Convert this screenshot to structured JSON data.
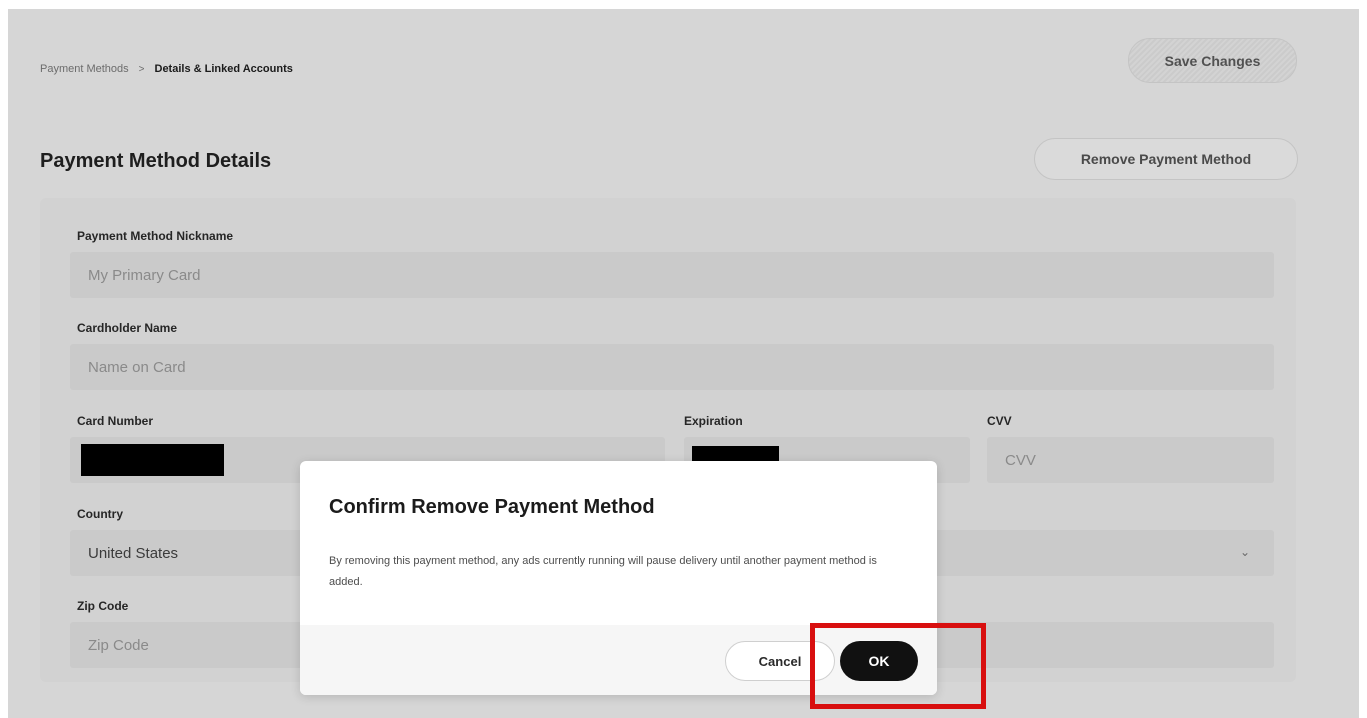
{
  "breadcrumb": {
    "parent": "Payment Methods",
    "separator": ">",
    "current": "Details & Linked Accounts"
  },
  "header": {
    "save_label": "Save Changes",
    "section_title": "Payment Method Details",
    "remove_label": "Remove Payment Method"
  },
  "form": {
    "nickname": {
      "label": "Payment Method Nickname",
      "placeholder": "My Primary Card"
    },
    "cardholder": {
      "label": "Cardholder Name",
      "placeholder": "Name on Card"
    },
    "card_number": {
      "label": "Card Number"
    },
    "expiration": {
      "label": "Expiration"
    },
    "cvv": {
      "label": "CVV",
      "placeholder": "CVV"
    },
    "country": {
      "label": "Country",
      "value": "United States",
      "icon": "chevron-down-icon"
    },
    "zip": {
      "label": "Zip Code",
      "placeholder": "Zip Code"
    }
  },
  "dialog": {
    "title": "Confirm Remove Payment Method",
    "body": "By removing this payment method, any ads currently running will pause delivery until another payment method is added.",
    "cancel_label": "Cancel",
    "ok_label": "OK"
  },
  "colors": {
    "highlight": "#d80f0f",
    "ok_button": "#111111"
  }
}
